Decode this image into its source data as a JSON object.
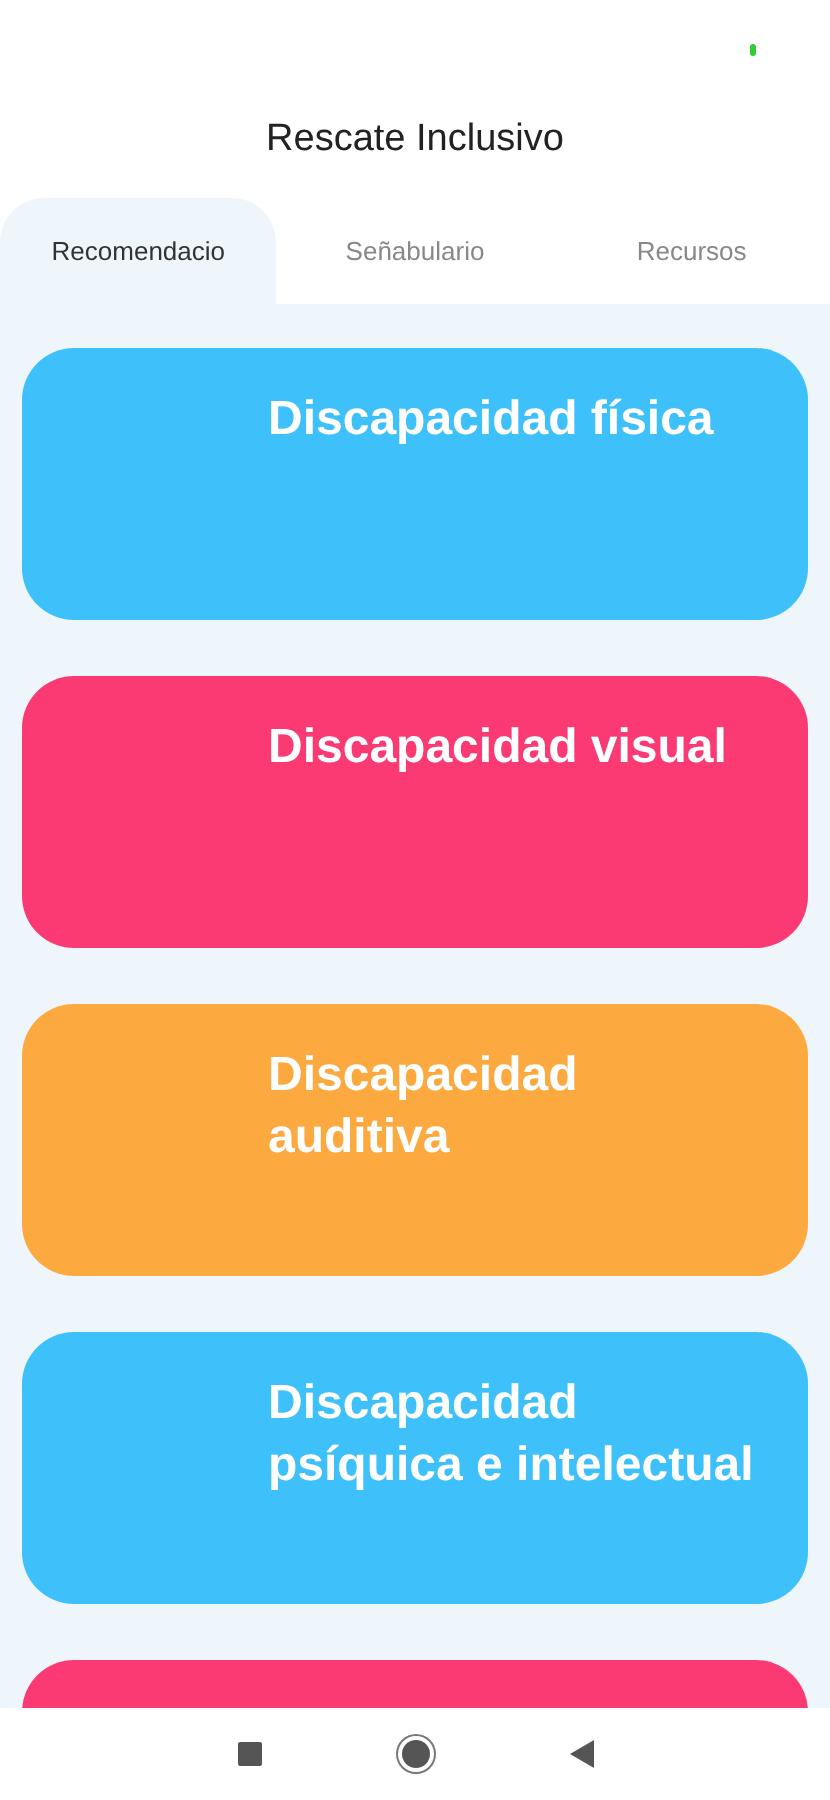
{
  "app_bar": {
    "title": "Rescate Inclusivo"
  },
  "tabs": [
    {
      "label": "Recomendacio",
      "selected": true
    },
    {
      "label": "Señabulario",
      "selected": false
    },
    {
      "label": "Recursos",
      "selected": false
    }
  ],
  "cards": [
    {
      "title": "Discapacidad física",
      "color": "#3ec0fa"
    },
    {
      "title": "Discapacidad visual",
      "color": "#fb3a74"
    },
    {
      "title": "Discapacidad auditiva",
      "color": "#fcaa40"
    },
    {
      "title": "Discapacidad psíquica e intelectual",
      "color": "#3ec0fa"
    },
    {
      "color": "#fb3a74"
    }
  ]
}
